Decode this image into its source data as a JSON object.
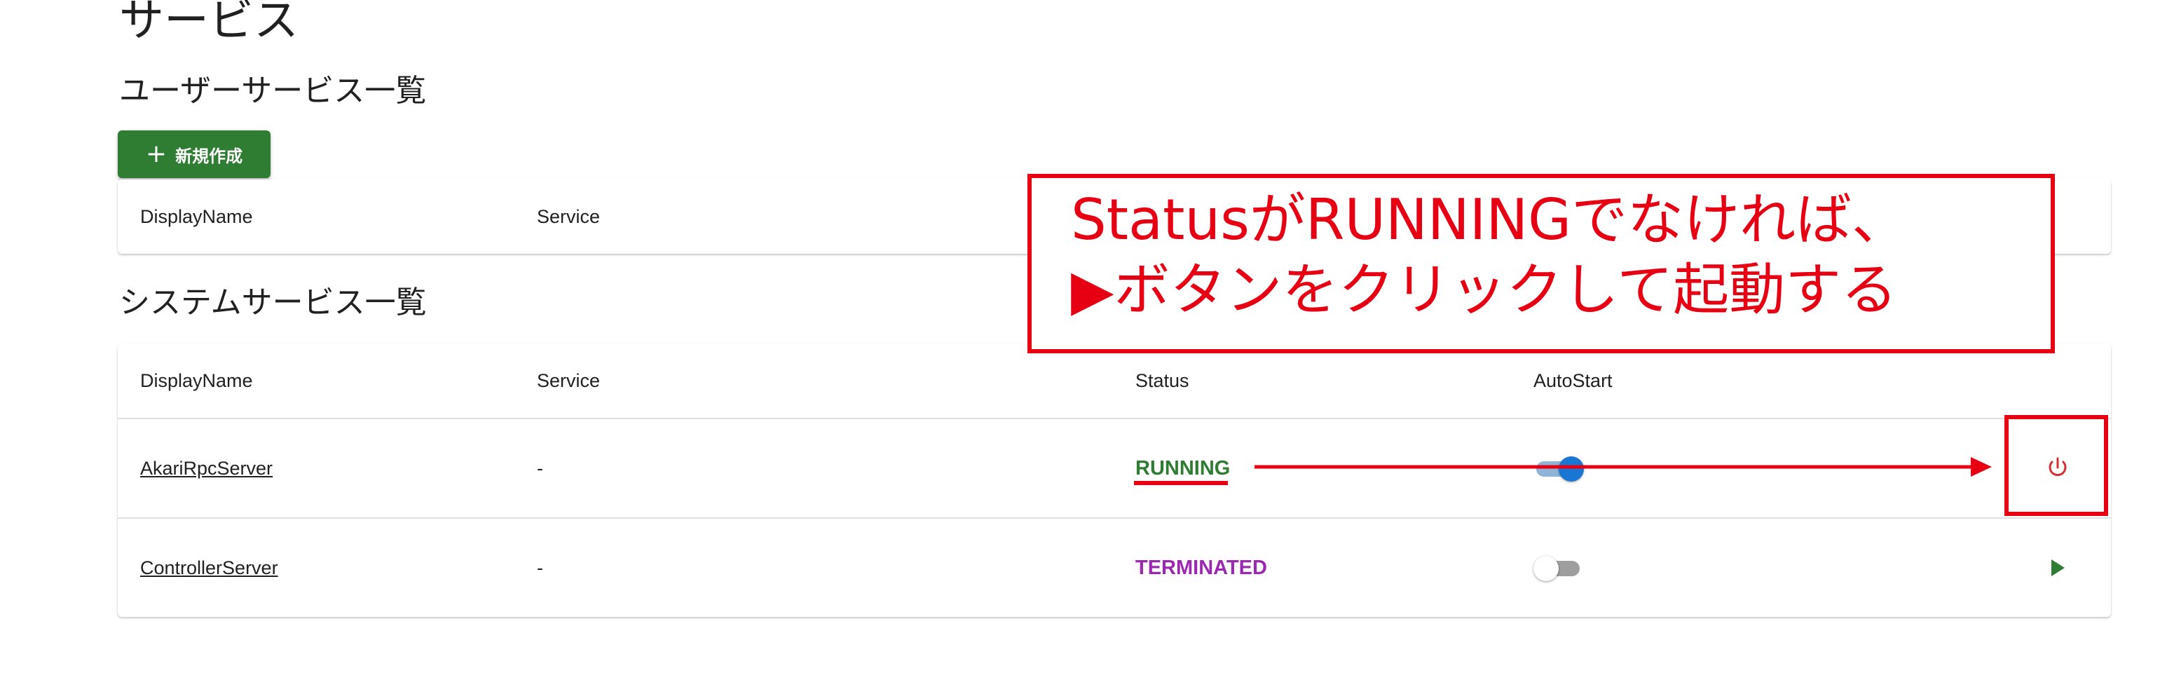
{
  "page": {
    "title": "サービス"
  },
  "user_services": {
    "title": "ユーザーサービス一覧",
    "new_button": {
      "icon": "plus-icon",
      "label": "新規作成"
    },
    "columns": [
      "DisplayName",
      "Service"
    ]
  },
  "system_services": {
    "title": "システムサービス一覧",
    "columns": [
      "DisplayName",
      "Service",
      "Status",
      "AutoStart"
    ],
    "rows": [
      {
        "display_name": "AkariRpcServer",
        "service": "-",
        "status": "RUNNING",
        "auto_start": true,
        "action_icon": "power-icon"
      },
      {
        "display_name": "ControllerServer",
        "service": "-",
        "status": "TERMINATED",
        "auto_start": false,
        "action_icon": "play-icon"
      }
    ]
  },
  "annotation": {
    "line1": "StatusがRUNNINGでなければ、",
    "line2": "▶ボタンをクリックして起動する"
  },
  "colors": {
    "primary_green": "#2e7d32",
    "running_green": "#2e7d32",
    "terminated_purple": "#9c27b0",
    "toggle_blue": "#1976d2",
    "annotation_red": "#e60012",
    "power_icon_red": "#d32f2f"
  }
}
